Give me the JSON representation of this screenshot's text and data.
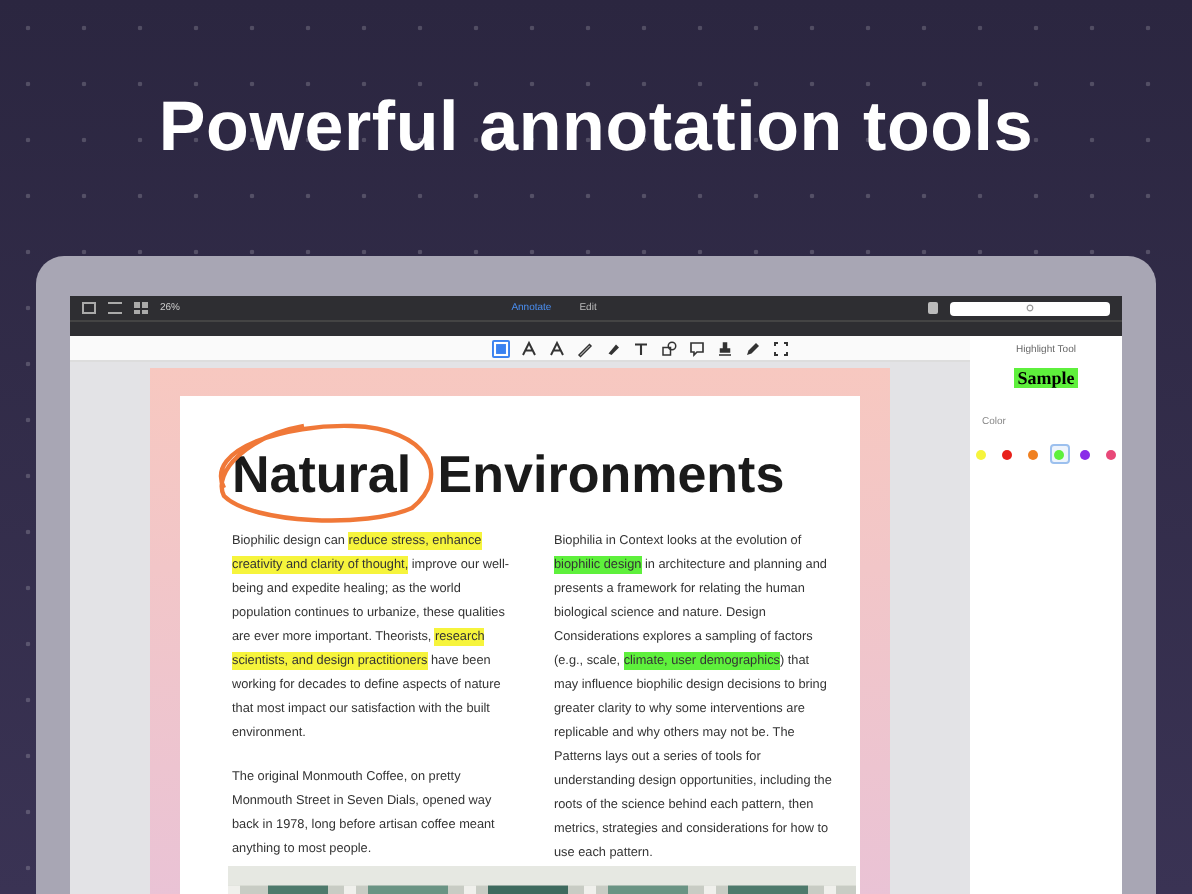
{
  "headline": "Powerful annotation tools",
  "toolbar": {
    "zoom": "26%",
    "modes": [
      {
        "label": "Annotate",
        "selected": true
      },
      {
        "label": "Edit",
        "selected": false
      }
    ]
  },
  "tools": [
    {
      "kind": "select",
      "selected": true
    },
    {
      "kind": "text-a",
      "selected": false
    },
    {
      "kind": "text-a",
      "selected": false
    },
    {
      "kind": "pen",
      "selected": false
    },
    {
      "kind": "eraser",
      "selected": false
    },
    {
      "kind": "text",
      "selected": false
    },
    {
      "kind": "shapes",
      "selected": false
    },
    {
      "kind": "note",
      "selected": false
    },
    {
      "kind": "stamp",
      "selected": false
    },
    {
      "kind": "pencil",
      "selected": false
    },
    {
      "kind": "expand",
      "selected": false
    }
  ],
  "document": {
    "title_circled": "Natural",
    "title_rest": " Environments",
    "columns": [
      [
        [
          {
            "text": "Biophilic design can "
          },
          {
            "text": "reduce stress, enhance creativity and clarity of thought,",
            "color": "#f6f43c"
          },
          {
            "text": " improve our well-being and expedite healing; as the world population continues to urbanize, these qualities are ever more important. Theorists, "
          },
          {
            "text": "research scientists, and design practitioners",
            "color": "#f6f43c"
          },
          {
            "text": " have been working for decades to define aspects of nature that most impact our satisfaction with the built environment."
          }
        ],
        [
          {
            "text": "The original Monmouth Coffee, on pretty Monmouth Street in Seven Dials, opened way back in 1978, long before artisan coffee meant anything to most people."
          }
        ]
      ],
      [
        [
          {
            "text": "Biophilia in Context looks at the evolution of "
          },
          {
            "text": "biophilic design",
            "color": "#5ef03c"
          },
          {
            "text": " in architecture and planning and presents a framework for relating the human biological science and nature. Design Considerations explores a sampling of factors (e.g., scale, "
          },
          {
            "text": "climate, user demographics",
            "color": "#5ef03c"
          },
          {
            "text": ") that may influence biophilic design decisions to bring greater clarity to why some interventions are replicable and why others may not be. The Patterns lays out a series of tools for understanding design opportunities, including the roots of the science behind each pattern, then metrics, strategies and considerations for how to use each pattern."
          }
        ]
      ]
    ]
  },
  "sidebar": {
    "title": "Highlight Tool",
    "sample": "Sample",
    "color_label": "Color",
    "colors": [
      {
        "color": "#f6f43c",
        "selected": false
      },
      {
        "color": "#e8201a",
        "selected": false
      },
      {
        "color": "#f08020",
        "selected": false
      },
      {
        "color": "#5ef03c",
        "selected": true
      },
      {
        "color": "#8a2be8",
        "selected": false
      },
      {
        "color": "#e84878",
        "selected": false
      }
    ]
  }
}
